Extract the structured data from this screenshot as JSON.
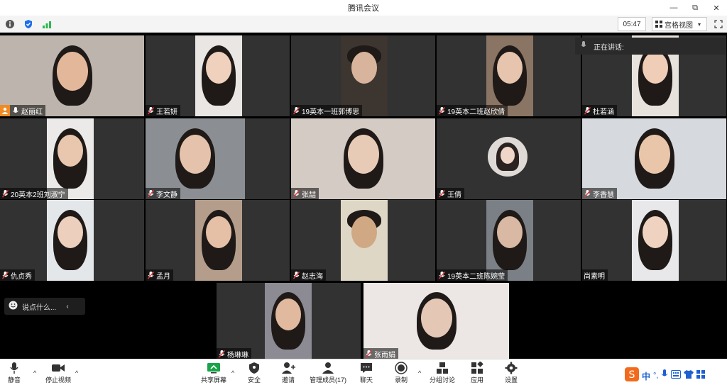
{
  "window": {
    "title": "腾讯会议",
    "controls": [
      "—",
      "⧉",
      "✕"
    ]
  },
  "infobar": {
    "timer": "05:47",
    "view_mode": "宫格视图"
  },
  "speaking": {
    "label": "正在讲话:"
  },
  "chat": {
    "placeholder": "说点什么..."
  },
  "participants": [
    {
      "name": "赵丽红",
      "bg": "#bdb5ad",
      "skin": "#e2b79a"
    },
    {
      "name": "王若妍",
      "bg": "#e9e6e4",
      "skin": "#f0d1bd"
    },
    {
      "name": "19英本一班郭博思",
      "bg": "#3d3530",
      "skin": "#d8b49c"
    },
    {
      "name": "19英本二班赵欣倩",
      "bg": "#8a7464",
      "skin": "#e6c4ad"
    },
    {
      "name": "杜若涵",
      "bg": "#e7e2dc",
      "skin": "#efcdb7"
    },
    {
      "name": "20英本2班刘淑宁",
      "bg": "#eceae8",
      "skin": "#e9c7ae"
    },
    {
      "name": "李文静",
      "bg": "#8b8f93",
      "skin": "#e4c2ab"
    },
    {
      "name": "张喆",
      "bg": "#d4cbc5",
      "skin": "#e8cbb6"
    },
    {
      "name": "王倩",
      "bg": "#e0dad7",
      "skin": "#f0d6c8"
    },
    {
      "name": "李香慧",
      "bg": "#d6d9de",
      "skin": "#e9c6aa"
    },
    {
      "name": "仇贞秀",
      "bg": "#e4e7ea",
      "skin": "#ecd0bd"
    },
    {
      "name": "孟月",
      "bg": "#b59d8c",
      "skin": "#e5c0a6"
    },
    {
      "name": "赵志海",
      "bg": "#ded7c6",
      "skin": "#d1a884"
    },
    {
      "name": "19英本二班陈婉莹",
      "bg": "#7b7f86",
      "skin": "#d9b9a3"
    },
    {
      "name": "尚素明",
      "bg": "#e8e8ea",
      "skin": "#efd3c0"
    },
    {
      "name": "杨琳琳",
      "bg": "#8c8a92",
      "skin": "#e0b99f"
    },
    {
      "name": "张雨娟",
      "bg": "#ece7e4",
      "skin": "#e5c7b5"
    }
  ],
  "toolbar": {
    "mute": "静音",
    "stop_video": "停止视频",
    "share": "共享屏幕",
    "security": "安全",
    "invite": "邀请",
    "members": "管理成员(17)",
    "chat": "聊天",
    "record": "录制",
    "breakout": "分组讨论",
    "apps": "应用",
    "settings": "设置"
  },
  "ime": {
    "lang": "中"
  }
}
